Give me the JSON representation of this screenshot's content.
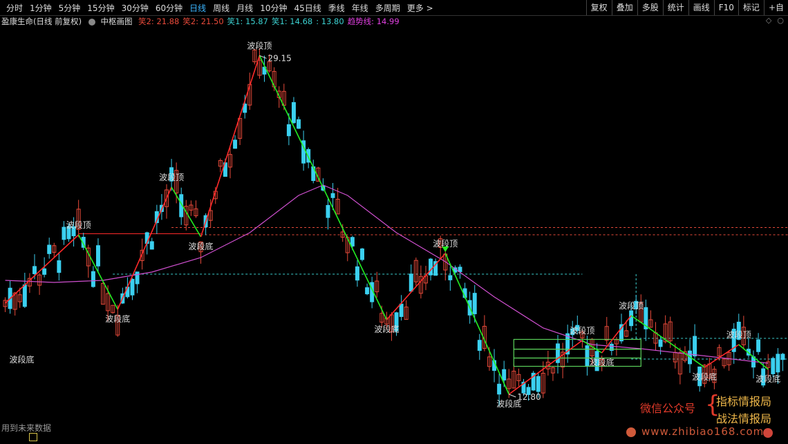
{
  "toolbar": {
    "periods": [
      "分时",
      "1分钟",
      "5分钟",
      "15分钟",
      "30分钟",
      "60分钟",
      "日线",
      "周线",
      "月线",
      "10分钟",
      "45日线",
      "季线",
      "年线",
      "多周期",
      "更多 >"
    ],
    "active_period": "日线",
    "tools": [
      "复权",
      "叠加",
      "多股",
      "统计",
      "画线",
      "F10",
      "标记",
      "+自"
    ]
  },
  "infobar": {
    "stock_name": "盈康生命(日线 前复权)",
    "indicator_name": "中枢画图",
    "values": [
      {
        "label": "笑2: 21.88",
        "color": "#e84a3a"
      },
      {
        "label": "笑2: 21.50",
        "color": "#e84a3a"
      },
      {
        "label": "笑1: 15.87",
        "color": "#3bd0d0"
      },
      {
        "label": "笑1: 14.68",
        "color": "#3bd0d0"
      },
      {
        "label": ": 13.80",
        "color": "#3bd0d0"
      },
      {
        "label": "趋势线: 14.99",
        "color": "#e040e0"
      }
    ],
    "right_icons": [
      "◇",
      "○"
    ]
  },
  "labels": {
    "peak_price": "29.15",
    "low_price": "12.80",
    "top": "波段顶",
    "bottom": "波段底"
  },
  "footer": {
    "text": "用到未来数据",
    "wechat": "微信公众号",
    "brand1": "指标情报局",
    "brand2": "战法情报局",
    "website": "www.zhibiao168.com"
  },
  "colors": {
    "up": "#e84a3a",
    "down": "#3bd0f0",
    "ma": "#d050d0",
    "wave_up": "#ff2a2a",
    "wave_down": "#22ee22",
    "zone_red": "#e84a3a",
    "zone_cyan": "#3bd0d0",
    "zone_green": "#5ad05a"
  },
  "chart_data": {
    "type": "candlestick",
    "price_range": [
      11.5,
      30.5
    ],
    "wave_points": [
      {
        "i": 0,
        "p": 17.2
      },
      {
        "i": 15,
        "p": 20.5
      },
      {
        "i": 23,
        "p": 16.9
      },
      {
        "i": 34,
        "p": 22.8
      },
      {
        "i": 40,
        "p": 20.4
      },
      {
        "i": 52,
        "p": 29.15
      },
      {
        "i": 78,
        "p": 16.4
      },
      {
        "i": 90,
        "p": 19.6
      },
      {
        "i": 103,
        "p": 12.8
      },
      {
        "i": 118,
        "p": 15.4
      },
      {
        "i": 122,
        "p": 14.8
      },
      {
        "i": 128,
        "p": 16.6
      },
      {
        "i": 143,
        "p": 14.1
      },
      {
        "i": 150,
        "p": 15.2
      },
      {
        "i": 156,
        "p": 14.0
      }
    ],
    "ma_points": [
      {
        "i": 0,
        "p": 18.3
      },
      {
        "i": 10,
        "p": 18.2
      },
      {
        "i": 20,
        "p": 18.3
      },
      {
        "i": 30,
        "p": 18.7
      },
      {
        "i": 40,
        "p": 19.4
      },
      {
        "i": 50,
        "p": 20.6
      },
      {
        "i": 60,
        "p": 22.4
      },
      {
        "i": 65,
        "p": 22.9
      },
      {
        "i": 70,
        "p": 22.4
      },
      {
        "i": 80,
        "p": 20.6
      },
      {
        "i": 90,
        "p": 19.2
      },
      {
        "i": 100,
        "p": 17.5
      },
      {
        "i": 110,
        "p": 16.0
      },
      {
        "i": 120,
        "p": 15.2
      },
      {
        "i": 130,
        "p": 15.0
      },
      {
        "i": 145,
        "p": 14.6
      },
      {
        "i": 156,
        "p": 14.3
      }
    ],
    "horizontal_lines": [
      {
        "p": 20.55,
        "from": 15,
        "to": 40,
        "style": "solid",
        "color_key": "wave_up"
      },
      {
        "p": 20.85,
        "from": 34,
        "to": 160,
        "style": "dashed",
        "color_key": "zone_red"
      },
      {
        "p": 20.5,
        "from": 40,
        "to": 160,
        "style": "dashed",
        "color_key": "zone_red"
      },
      {
        "p": 18.6,
        "from": 22,
        "to": 118,
        "style": "dashed",
        "color_key": "zone_cyan"
      },
      {
        "p": 15.5,
        "from": 128,
        "to": 160,
        "style": "dashed",
        "color_key": "zone_cyan"
      },
      {
        "p": 14.5,
        "from": 128,
        "to": 160,
        "style": "dashed",
        "color_key": "zone_cyan"
      }
    ],
    "zones": [
      {
        "from": 104,
        "to": 130,
        "top": 15.45,
        "bottom": 14.98
      },
      {
        "from": 104,
        "to": 130,
        "top": 14.98,
        "bottom": 14.55
      },
      {
        "from": 104,
        "to": 130,
        "top": 14.55,
        "bottom": 14.15
      }
    ],
    "cyan_vertical": {
      "i": 129,
      "from_p": 18.6,
      "to_p": 15.45
    }
  }
}
